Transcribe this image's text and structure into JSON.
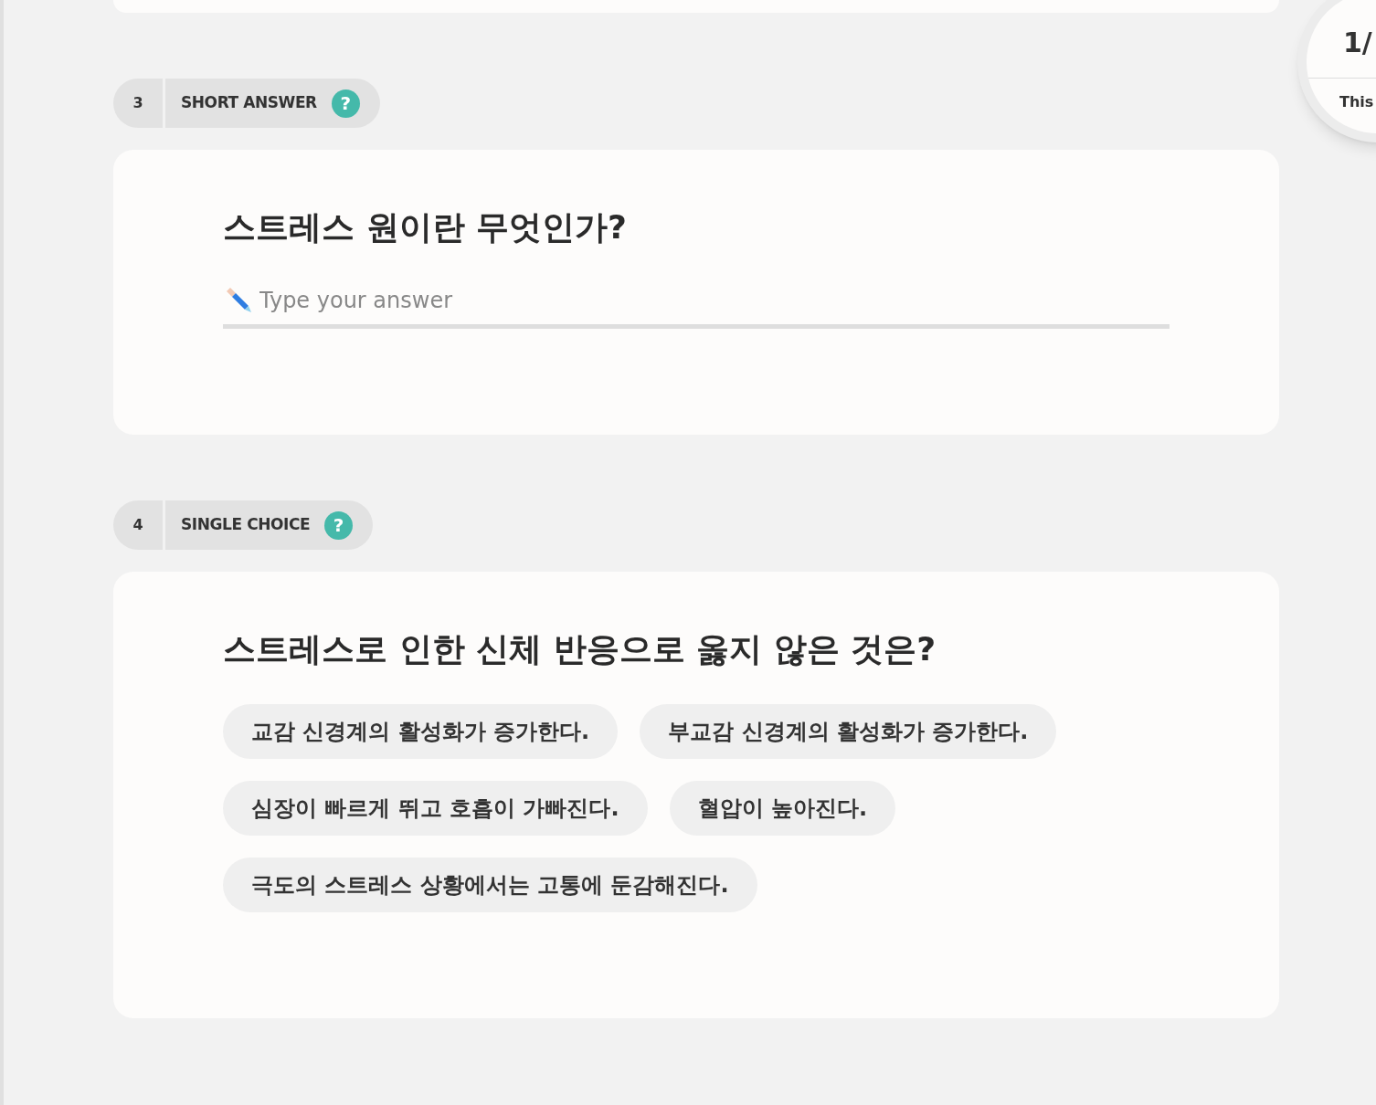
{
  "questions": [
    {
      "number": "3",
      "type_label": "SHORT ANSWER",
      "help": "?",
      "kind": "short",
      "title": "스트레스 원이란 무엇인가?",
      "placeholder": "Type your answer"
    },
    {
      "number": "4",
      "type_label": "SINGLE CHOICE",
      "help": "?",
      "kind": "choice",
      "title": "스트레스로 인한 신체 반응으로 옳지 않은 것은?",
      "options": [
        {
          "label": "교감 신경계의 활성화가 증가한다.",
          "selected": false
        },
        {
          "label": "부교감 신경계의 활성화가 증가한다.",
          "selected": false
        },
        {
          "label": "심장이 빠르게 뛰고 호흡이 가빠진다.",
          "selected": false
        },
        {
          "label": "혈압이 높아진다.",
          "selected": false
        },
        {
          "label": "극도의 스트레스 상황에서는 고통에 둔감해진다.",
          "selected": false
        }
      ]
    }
  ],
  "progress": {
    "count": "1/",
    "caption": "This"
  }
}
